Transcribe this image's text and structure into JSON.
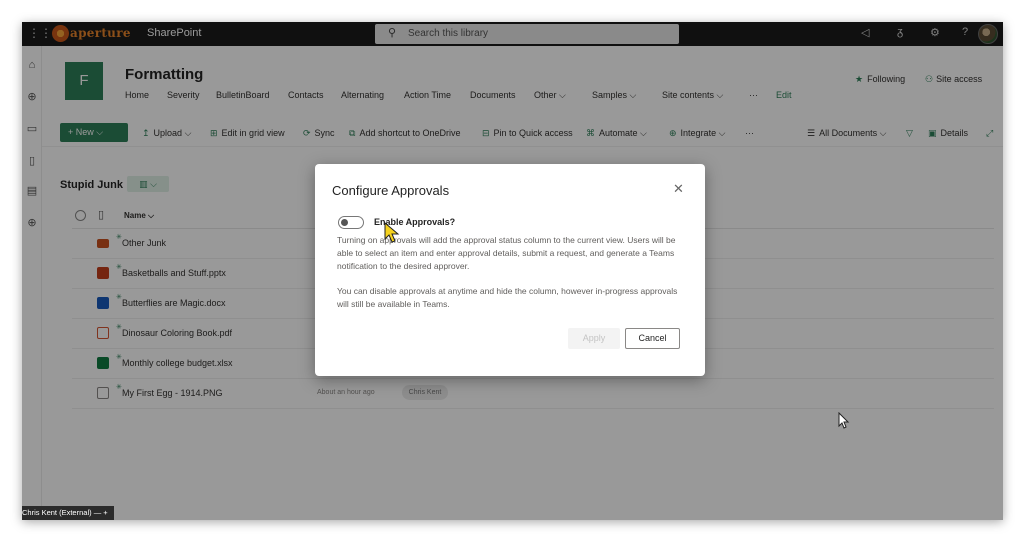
{
  "topbar": {
    "logo_text": "aperture",
    "app_name": "SharePoint",
    "search_placeholder": "Search this library",
    "help_glyph": "?"
  },
  "site": {
    "logo_letter": "F",
    "title": "Formatting",
    "nav": [
      "Home",
      "Severity",
      "BulletinBoard",
      "Contacts",
      "Alternating",
      "Action Time",
      "Documents",
      "Other ⌵",
      "Samples ⌵",
      "Site contents ⌵",
      "···",
      "Edit"
    ],
    "following": "Following",
    "site_access": "Site access"
  },
  "command_bar": {
    "new": "+ New ⌵",
    "upload": "Upload ⌵",
    "edit_grid": "Edit in grid view",
    "sync": "Sync",
    "add_shortcut": "Add shortcut to OneDrive",
    "pin": "Pin to Quick access",
    "automate": "Automate ⌵",
    "integrate": "Integrate ⌵",
    "more": "···",
    "all_documents": "All Documents ⌵",
    "details": "Details"
  },
  "library": {
    "title": "Stupid Junk",
    "view_badge": "▥ ⌵",
    "name_header": "Name ⌵",
    "files": [
      {
        "name": "Other Junk",
        "icon": "folder-icon",
        "color": "#c8501e"
      },
      {
        "name": "Basketballs and Stuff.pptx",
        "icon": "powerpoint-icon",
        "color": "#c43e1c"
      },
      {
        "name": "Butterflies are Magic.docx",
        "icon": "word-icon",
        "color": "#185abd"
      },
      {
        "name": "Dinosaur Coloring Book.pdf",
        "icon": "pdf-icon",
        "color": "#d65532"
      },
      {
        "name": "Monthly college budget.xlsx",
        "icon": "excel-icon",
        "color": "#107c41"
      },
      {
        "name": "My First Egg - 1914.PNG",
        "icon": "image-icon",
        "color": "#8a8886",
        "modified": "About an hour ago",
        "modified_by": "Chris Kent"
      }
    ]
  },
  "dialog": {
    "title": "Configure Approvals",
    "close": "✕",
    "toggle_label": "Enable Approvals?",
    "paragraph1": "Turning on approvals will add the approval status column to the current view. Users will be able to select an item and enter approval details, submit a request, and generate a Teams notification to the desired approver.",
    "paragraph2": "You can disable approvals at anytime and hide the column, however in-progress approvals will still be available in Teams.",
    "apply": "Apply",
    "cancel": "Cancel"
  },
  "status_tag": "Chris Kent (External)  —  +",
  "colors": {
    "brand": "#2e7f59",
    "topbar": "#1b1b1b"
  }
}
